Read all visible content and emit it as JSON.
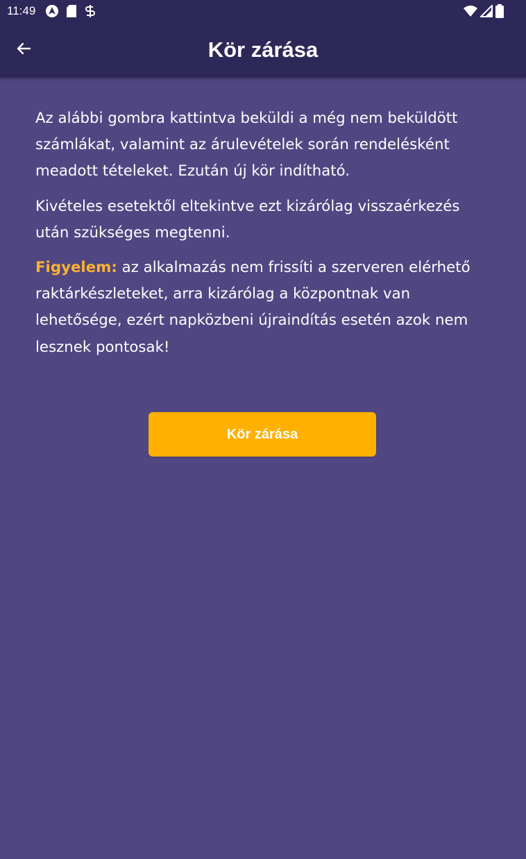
{
  "status_bar": {
    "time": "11:49",
    "left_icons": [
      "android-auto-icon",
      "sd-card-icon",
      "sync-icon"
    ],
    "right_icons": [
      "wifi-icon",
      "cell-signal-icon",
      "battery-icon"
    ]
  },
  "app_bar": {
    "title": "Kör zárása",
    "back_icon": "arrow-back-icon"
  },
  "content": {
    "paragraph_1": "Az alábbi gombra kattintva beküldi a még nem beküldött számlákat, valamint az árulevételek során rendelésként meadott tételeket. Ezután új kör indítható.",
    "paragraph_2": "Kivételes esetektől eltekintve ezt kizárólag visszaérkezés után szükséges megtenni.",
    "warning_label": "Figyelem:",
    "warning_text": " az alkalmazás nem frissíti a szerveren elérhető raktárkészleteket, arra kizárólag a központnak van lehetősége, ezért napközbeni újraindítás esetén azok nem lesznek pontosak!"
  },
  "action": {
    "close_round_label": "Kör zárása"
  },
  "colors": {
    "background": "#504782",
    "app_bar": "#2e2859",
    "accent": "#ffb000",
    "warning": "#fdb130"
  }
}
